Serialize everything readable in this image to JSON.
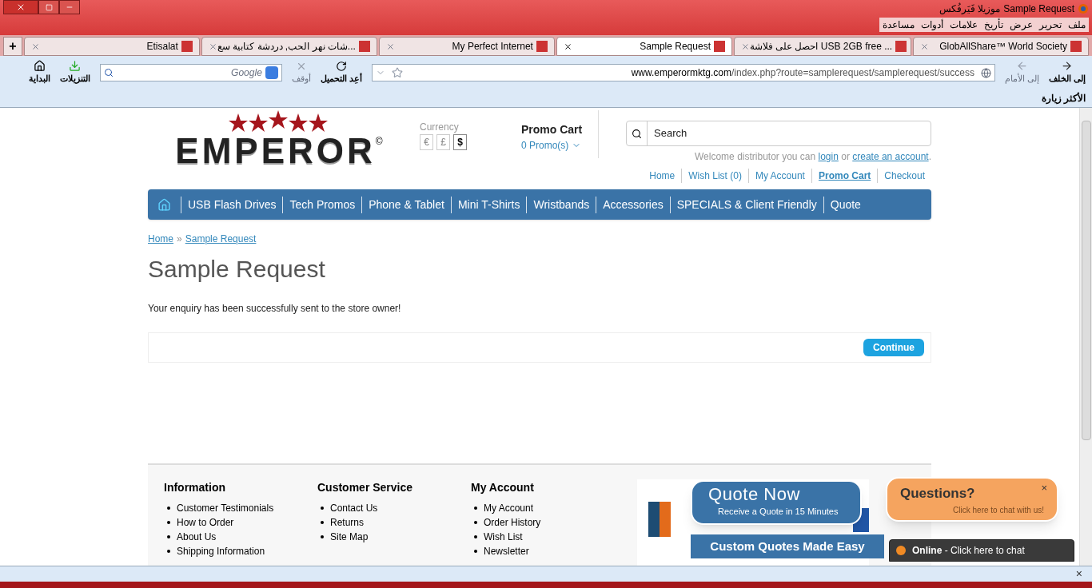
{
  "window": {
    "title": "Sample Request",
    "app_name": "موزيلا فَيَرفُكس"
  },
  "menu": [
    "ملف",
    "تحرير",
    "عرض",
    "تأريخ",
    "علامات",
    "أدوات",
    "مساعدة"
  ],
  "tabs": [
    {
      "label": "Etisalat",
      "selected": false
    },
    {
      "label": "شات نهر الحب, دردشة كتابية سع...",
      "selected": false
    },
    {
      "label": "My Perfect Internet",
      "selected": false
    },
    {
      "label": "Sample Request",
      "selected": true
    },
    {
      "label": "احصل على فلاشة USB 2GB free ...",
      "selected": false
    },
    {
      "label": "GlobAllShare™ World Society",
      "selected": false
    }
  ],
  "new_tab": "+",
  "nav": {
    "back": "إلى الخلف",
    "forward": "إلى الأمام",
    "url_domain": "www.emperormktg.com",
    "url_path": "/index.php?route=samplerequest/samplerequest/success",
    "reload": "أعِد التحميل",
    "stop": "أوقف",
    "search_placeholder": "Google",
    "downloads": "التنزيلات",
    "home": "البداية"
  },
  "bookmarks": [
    "الأكثر زيارة"
  ],
  "store": {
    "logo": "EMPEROR",
    "logo_mark": "©",
    "currency_label": "Currency",
    "currencies": [
      {
        "symbol": "€",
        "selected": false
      },
      {
        "symbol": "£",
        "selected": false
      },
      {
        "symbol": "$",
        "selected": true
      }
    ],
    "cart_title": "Promo Cart",
    "cart_count": "0 Promo(s)",
    "search_placeholder": "Search",
    "welcome": "Welcome distributor you can",
    "login": "login",
    "or": "or",
    "create": "create an account",
    "dot": ".",
    "top_links": [
      {
        "label": "Home",
        "selected": false
      },
      {
        "label": "Wish List (0)",
        "selected": false
      },
      {
        "label": "My Account",
        "selected": false
      },
      {
        "label": "Promo Cart",
        "selected": true
      },
      {
        "label": "Checkout",
        "selected": false
      }
    ],
    "menu": [
      "USB Flash Drives",
      "Tech Promos",
      "Phone & Tablet",
      "Mini T-Shirts",
      "Wristbands",
      "Accessories",
      "SPECIALS & Client Friendly",
      "Quote"
    ]
  },
  "breadcrumb": [
    "Home",
    "»",
    "Sample Request"
  ],
  "heading": "Sample Request",
  "message": "Your enquiry has been successfully sent to the store owner!",
  "continue": "Continue",
  "footer": [
    {
      "title": "Information",
      "links": [
        "Customer Testimonials",
        "How to Order",
        "About Us",
        "Shipping Information"
      ]
    },
    {
      "title": "Customer Service",
      "links": [
        "Contact Us",
        "Returns",
        "Site Map"
      ]
    },
    {
      "title": "My Account",
      "links": [
        "My Account",
        "Order History",
        "Wish List",
        "Newsletter"
      ]
    }
  ],
  "quote_bubble": {
    "title": "Quote Now",
    "subtitle": "Receive a Quote in 15 Minutes",
    "banner": "Custom Quotes Made Easy"
  },
  "chat": {
    "title": "Questions?",
    "subtitle": "Click here to chat with us!",
    "close": "×",
    "status": "Online",
    "status_text": "- Click here to chat"
  },
  "status_bar": {
    "close": "×"
  }
}
